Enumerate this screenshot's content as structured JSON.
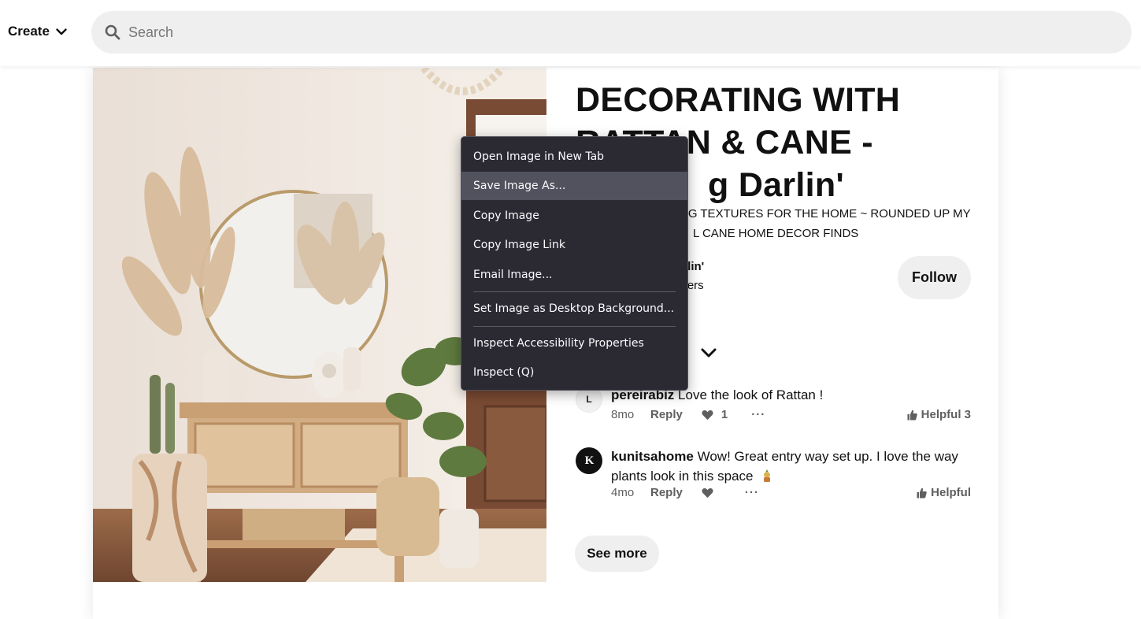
{
  "topbar": {
    "create_label": "Create",
    "search_placeholder": "Search",
    "icons": [
      "chevron-down-icon",
      "search-icon"
    ]
  },
  "pin": {
    "title": "DECORATING WITH RATTAN & CANE - ...g Darlin'",
    "title_visible_lines": [
      "DECORATING WITH",
      "RATTAN & CANE -",
      "g Darlin'"
    ],
    "description_visible_lines": [
      "NG TEXTURES FOR THE HOME ~ ROUNDED UP MY",
      "L CANE HOME DECOR FINDS"
    ],
    "owner_name_visible": "arlin'",
    "owner_followers_visible": "wers",
    "follow_label": "Follow"
  },
  "comments": [
    {
      "avatar_letter": "L",
      "username": "pereirabiz",
      "text": "Love the look of Rattan !",
      "time": "8mo",
      "reply_label": "Reply",
      "likes": "1",
      "more": "···",
      "helpful_label": "Helpful 3"
    },
    {
      "avatar_letter": "K",
      "username": "kunitsahome",
      "text": "Wow! Great entry way set up. I love the way plants look in this space",
      "time": "4mo",
      "reply_label": "Reply",
      "likes": "",
      "more": "···",
      "helpful_label": "Helpful"
    }
  ],
  "see_more_label": "See more",
  "context_menu": {
    "items": [
      {
        "label": "Open Image in New Tab",
        "highlighted": false
      },
      {
        "label": "Save Image As...",
        "highlighted": true
      },
      {
        "label": "Copy Image",
        "highlighted": false
      },
      {
        "label": "Copy Image Link",
        "highlighted": false
      },
      {
        "label": "Email Image...",
        "highlighted": false
      },
      {
        "label": "Set Image as Desktop Background...",
        "highlighted": false
      },
      {
        "label": "Inspect Accessibility Properties",
        "highlighted": false
      },
      {
        "label": "Inspect (Q)",
        "highlighted": false
      }
    ]
  },
  "colors": {
    "menu_bg": "#2b2a33",
    "menu_highlight": "#52525e",
    "button_bg": "#efefef"
  }
}
